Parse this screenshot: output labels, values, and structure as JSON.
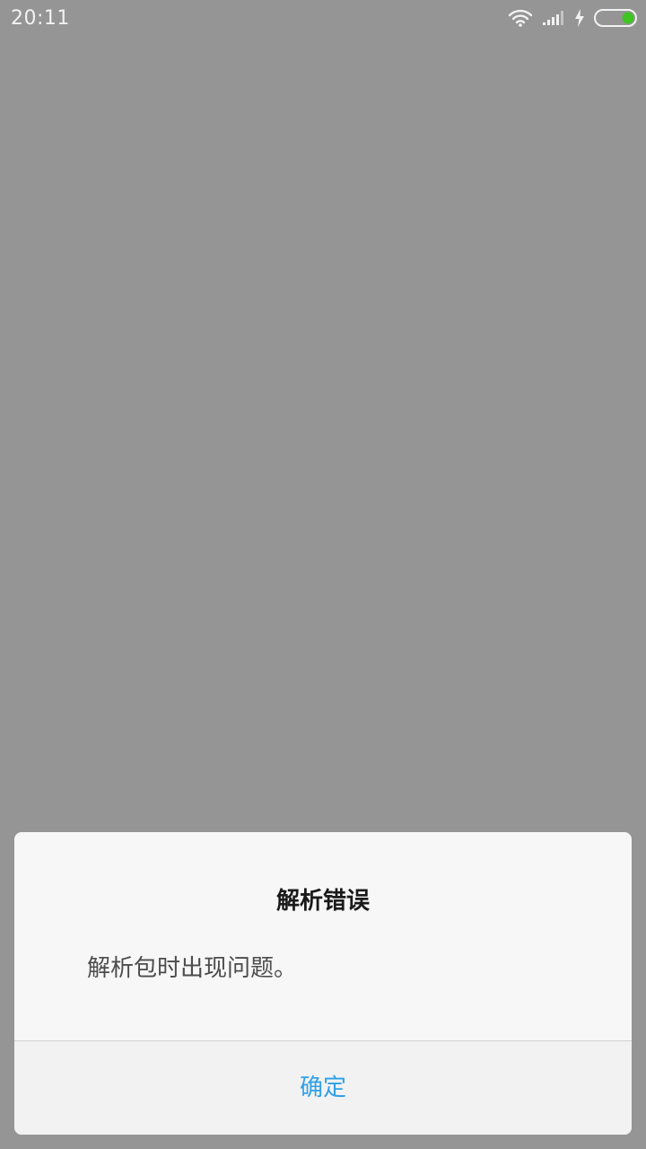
{
  "status_bar": {
    "time": "20:11",
    "icons": [
      "wifi-icon",
      "signal-icon",
      "charging-icon",
      "battery-icon"
    ],
    "battery_color": "#3fc424"
  },
  "dialog": {
    "title": "解析错误",
    "message": "解析包时出现问题。",
    "confirm_label": "确定",
    "accent_color": "#2fa0e8"
  },
  "background_color": "#959595"
}
